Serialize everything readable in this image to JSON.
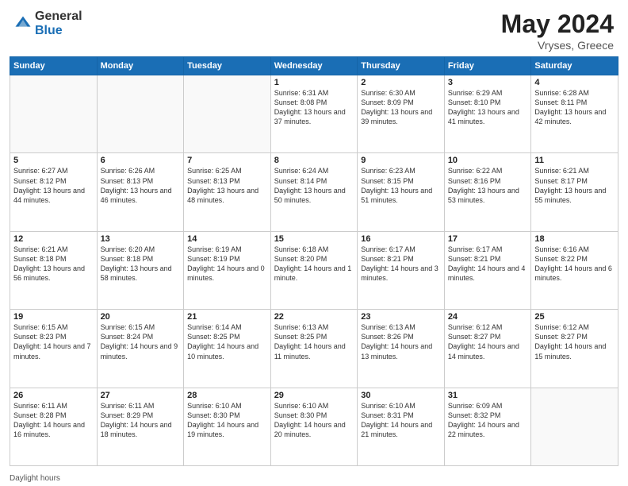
{
  "header": {
    "logo_general": "General",
    "logo_blue": "Blue",
    "month_title": "May 2024",
    "location": "Vryses, Greece"
  },
  "footer": {
    "note": "Daylight hours"
  },
  "days_of_week": [
    "Sunday",
    "Monday",
    "Tuesday",
    "Wednesday",
    "Thursday",
    "Friday",
    "Saturday"
  ],
  "weeks": [
    [
      {
        "day": "",
        "empty": true
      },
      {
        "day": "",
        "empty": true
      },
      {
        "day": "",
        "empty": true
      },
      {
        "day": "1",
        "sunrise": "Sunrise: 6:31 AM",
        "sunset": "Sunset: 8:08 PM",
        "daylight": "Daylight: 13 hours and 37 minutes."
      },
      {
        "day": "2",
        "sunrise": "Sunrise: 6:30 AM",
        "sunset": "Sunset: 8:09 PM",
        "daylight": "Daylight: 13 hours and 39 minutes."
      },
      {
        "day": "3",
        "sunrise": "Sunrise: 6:29 AM",
        "sunset": "Sunset: 8:10 PM",
        "daylight": "Daylight: 13 hours and 41 minutes."
      },
      {
        "day": "4",
        "sunrise": "Sunrise: 6:28 AM",
        "sunset": "Sunset: 8:11 PM",
        "daylight": "Daylight: 13 hours and 42 minutes."
      }
    ],
    [
      {
        "day": "5",
        "sunrise": "Sunrise: 6:27 AM",
        "sunset": "Sunset: 8:12 PM",
        "daylight": "Daylight: 13 hours and 44 minutes."
      },
      {
        "day": "6",
        "sunrise": "Sunrise: 6:26 AM",
        "sunset": "Sunset: 8:13 PM",
        "daylight": "Daylight: 13 hours and 46 minutes."
      },
      {
        "day": "7",
        "sunrise": "Sunrise: 6:25 AM",
        "sunset": "Sunset: 8:13 PM",
        "daylight": "Daylight: 13 hours and 48 minutes."
      },
      {
        "day": "8",
        "sunrise": "Sunrise: 6:24 AM",
        "sunset": "Sunset: 8:14 PM",
        "daylight": "Daylight: 13 hours and 50 minutes."
      },
      {
        "day": "9",
        "sunrise": "Sunrise: 6:23 AM",
        "sunset": "Sunset: 8:15 PM",
        "daylight": "Daylight: 13 hours and 51 minutes."
      },
      {
        "day": "10",
        "sunrise": "Sunrise: 6:22 AM",
        "sunset": "Sunset: 8:16 PM",
        "daylight": "Daylight: 13 hours and 53 minutes."
      },
      {
        "day": "11",
        "sunrise": "Sunrise: 6:21 AM",
        "sunset": "Sunset: 8:17 PM",
        "daylight": "Daylight: 13 hours and 55 minutes."
      }
    ],
    [
      {
        "day": "12",
        "sunrise": "Sunrise: 6:21 AM",
        "sunset": "Sunset: 8:18 PM",
        "daylight": "Daylight: 13 hours and 56 minutes."
      },
      {
        "day": "13",
        "sunrise": "Sunrise: 6:20 AM",
        "sunset": "Sunset: 8:18 PM",
        "daylight": "Daylight: 13 hours and 58 minutes."
      },
      {
        "day": "14",
        "sunrise": "Sunrise: 6:19 AM",
        "sunset": "Sunset: 8:19 PM",
        "daylight": "Daylight: 14 hours and 0 minutes."
      },
      {
        "day": "15",
        "sunrise": "Sunrise: 6:18 AM",
        "sunset": "Sunset: 8:20 PM",
        "daylight": "Daylight: 14 hours and 1 minute."
      },
      {
        "day": "16",
        "sunrise": "Sunrise: 6:17 AM",
        "sunset": "Sunset: 8:21 PM",
        "daylight": "Daylight: 14 hours and 3 minutes."
      },
      {
        "day": "17",
        "sunrise": "Sunrise: 6:17 AM",
        "sunset": "Sunset: 8:21 PM",
        "daylight": "Daylight: 14 hours and 4 minutes."
      },
      {
        "day": "18",
        "sunrise": "Sunrise: 6:16 AM",
        "sunset": "Sunset: 8:22 PM",
        "daylight": "Daylight: 14 hours and 6 minutes."
      }
    ],
    [
      {
        "day": "19",
        "sunrise": "Sunrise: 6:15 AM",
        "sunset": "Sunset: 8:23 PM",
        "daylight": "Daylight: 14 hours and 7 minutes."
      },
      {
        "day": "20",
        "sunrise": "Sunrise: 6:15 AM",
        "sunset": "Sunset: 8:24 PM",
        "daylight": "Daylight: 14 hours and 9 minutes."
      },
      {
        "day": "21",
        "sunrise": "Sunrise: 6:14 AM",
        "sunset": "Sunset: 8:25 PM",
        "daylight": "Daylight: 14 hours and 10 minutes."
      },
      {
        "day": "22",
        "sunrise": "Sunrise: 6:13 AM",
        "sunset": "Sunset: 8:25 PM",
        "daylight": "Daylight: 14 hours and 11 minutes."
      },
      {
        "day": "23",
        "sunrise": "Sunrise: 6:13 AM",
        "sunset": "Sunset: 8:26 PM",
        "daylight": "Daylight: 14 hours and 13 minutes."
      },
      {
        "day": "24",
        "sunrise": "Sunrise: 6:12 AM",
        "sunset": "Sunset: 8:27 PM",
        "daylight": "Daylight: 14 hours and 14 minutes."
      },
      {
        "day": "25",
        "sunrise": "Sunrise: 6:12 AM",
        "sunset": "Sunset: 8:27 PM",
        "daylight": "Daylight: 14 hours and 15 minutes."
      }
    ],
    [
      {
        "day": "26",
        "sunrise": "Sunrise: 6:11 AM",
        "sunset": "Sunset: 8:28 PM",
        "daylight": "Daylight: 14 hours and 16 minutes."
      },
      {
        "day": "27",
        "sunrise": "Sunrise: 6:11 AM",
        "sunset": "Sunset: 8:29 PM",
        "daylight": "Daylight: 14 hours and 18 minutes."
      },
      {
        "day": "28",
        "sunrise": "Sunrise: 6:10 AM",
        "sunset": "Sunset: 8:30 PM",
        "daylight": "Daylight: 14 hours and 19 minutes."
      },
      {
        "day": "29",
        "sunrise": "Sunrise: 6:10 AM",
        "sunset": "Sunset: 8:30 PM",
        "daylight": "Daylight: 14 hours and 20 minutes."
      },
      {
        "day": "30",
        "sunrise": "Sunrise: 6:10 AM",
        "sunset": "Sunset: 8:31 PM",
        "daylight": "Daylight: 14 hours and 21 minutes."
      },
      {
        "day": "31",
        "sunrise": "Sunrise: 6:09 AM",
        "sunset": "Sunset: 8:32 PM",
        "daylight": "Daylight: 14 hours and 22 minutes."
      },
      {
        "day": "",
        "empty": true
      }
    ]
  ]
}
